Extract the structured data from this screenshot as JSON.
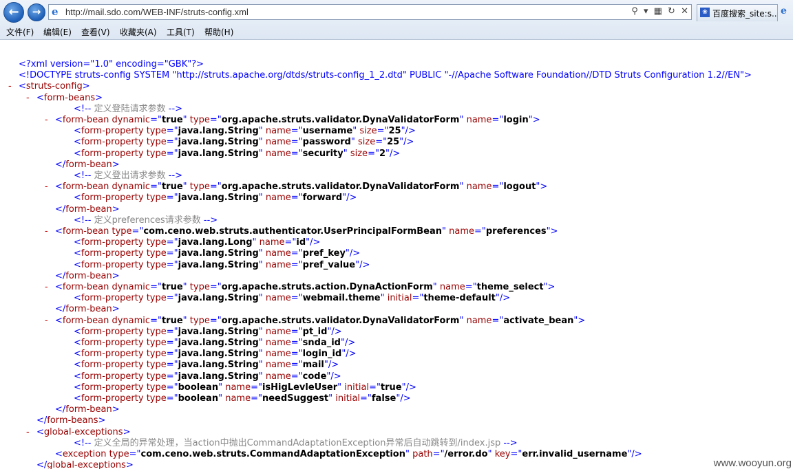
{
  "browser": {
    "url": "http://mail.sdo.com/WEB-INF/struts-config.xml",
    "tab_title": "百度搜索_site:s...",
    "menu": [
      "文件(F)",
      "编辑(E)",
      "查看(V)",
      "收藏夹(A)",
      "工具(T)",
      "帮助(H)"
    ],
    "icons": [
      "back-arrow-icon",
      "forward-arrow-icon",
      "ie-icon",
      "search-icon",
      "dropdown-icon",
      "compatibility-icon",
      "refresh-icon",
      "stop-icon",
      "baidu-icon"
    ]
  },
  "xml_lines": [
    {
      "indent": 0,
      "parts": [
        [
          "blue",
          "<?xml version=\"1.0\" encoding=\"GBK\"?>"
        ]
      ]
    },
    {
      "indent": 0,
      "parts": [
        [
          "blue",
          "<!DOCTYPE struts-config SYSTEM \"http://struts.apache.org/dtds/struts-config_1_2.dtd\" PUBLIC \"-//Apache Software Foundation//DTD Struts Configuration 1.2//EN\">"
        ]
      ]
    },
    {
      "indent": 0,
      "collapse": "-",
      "parts": [
        [
          "blue",
          "<"
        ],
        [
          "red",
          "struts-config"
        ],
        [
          "blue",
          ">"
        ]
      ]
    },
    {
      "indent": 1,
      "collapse": "-",
      "parts": [
        [
          "blue",
          "<"
        ],
        [
          "red",
          "form-beans"
        ],
        [
          "blue",
          ">"
        ]
      ]
    },
    {
      "indent": 3,
      "parts": [
        [
          "blue",
          "<!--"
        ],
        [
          "cmt",
          " 定义登陆请求参数 "
        ],
        [
          "blue",
          "-->"
        ]
      ]
    },
    {
      "indent": 2,
      "collapse": "-",
      "parts": [
        [
          "blue",
          "<"
        ],
        [
          "red",
          "form-bean dynamic"
        ],
        [
          "blue",
          "=\""
        ],
        [
          "val",
          "true"
        ],
        [
          "blue",
          "\" "
        ],
        [
          "red",
          "type"
        ],
        [
          "blue",
          "=\""
        ],
        [
          "val",
          "org.apache.struts.validator.DynaValidatorForm"
        ],
        [
          "blue",
          "\" "
        ],
        [
          "red",
          "name"
        ],
        [
          "blue",
          "=\""
        ],
        [
          "val",
          "login"
        ],
        [
          "blue",
          "\">"
        ]
      ]
    },
    {
      "indent": 3,
      "parts": [
        [
          "blue",
          "<"
        ],
        [
          "red",
          "form-property type"
        ],
        [
          "blue",
          "=\""
        ],
        [
          "val",
          "java.lang.String"
        ],
        [
          "blue",
          "\" "
        ],
        [
          "red",
          "name"
        ],
        [
          "blue",
          "=\""
        ],
        [
          "val",
          "username"
        ],
        [
          "blue",
          "\" "
        ],
        [
          "red",
          "size"
        ],
        [
          "blue",
          "=\""
        ],
        [
          "val",
          "25"
        ],
        [
          "blue",
          "\"/>"
        ]
      ]
    },
    {
      "indent": 3,
      "parts": [
        [
          "blue",
          "<"
        ],
        [
          "red",
          "form-property type"
        ],
        [
          "blue",
          "=\""
        ],
        [
          "val",
          "java.lang.String"
        ],
        [
          "blue",
          "\" "
        ],
        [
          "red",
          "name"
        ],
        [
          "blue",
          "=\""
        ],
        [
          "val",
          "password"
        ],
        [
          "blue",
          "\" "
        ],
        [
          "red",
          "size"
        ],
        [
          "blue",
          "=\""
        ],
        [
          "val",
          "25"
        ],
        [
          "blue",
          "\"/>"
        ]
      ]
    },
    {
      "indent": 3,
      "parts": [
        [
          "blue",
          "<"
        ],
        [
          "red",
          "form-property type"
        ],
        [
          "blue",
          "=\""
        ],
        [
          "val",
          "java.lang.String"
        ],
        [
          "blue",
          "\" "
        ],
        [
          "red",
          "name"
        ],
        [
          "blue",
          "=\""
        ],
        [
          "val",
          "security"
        ],
        [
          "blue",
          "\" "
        ],
        [
          "red",
          "size"
        ],
        [
          "blue",
          "=\""
        ],
        [
          "val",
          "2"
        ],
        [
          "blue",
          "\"/>"
        ]
      ]
    },
    {
      "indent": 2,
      "parts": [
        [
          "blue",
          "</"
        ],
        [
          "red",
          "form-bean"
        ],
        [
          "blue",
          ">"
        ]
      ]
    },
    {
      "indent": 3,
      "parts": [
        [
          "blue",
          "<!--"
        ],
        [
          "cmt",
          " 定义登出请求参数 "
        ],
        [
          "blue",
          "-->"
        ]
      ]
    },
    {
      "indent": 2,
      "collapse": "-",
      "parts": [
        [
          "blue",
          "<"
        ],
        [
          "red",
          "form-bean dynamic"
        ],
        [
          "blue",
          "=\""
        ],
        [
          "val",
          "true"
        ],
        [
          "blue",
          "\" "
        ],
        [
          "red",
          "type"
        ],
        [
          "blue",
          "=\""
        ],
        [
          "val",
          "org.apache.struts.validator.DynaValidatorForm"
        ],
        [
          "blue",
          "\" "
        ],
        [
          "red",
          "name"
        ],
        [
          "blue",
          "=\""
        ],
        [
          "val",
          "logout"
        ],
        [
          "blue",
          "\">"
        ]
      ]
    },
    {
      "indent": 3,
      "parts": [
        [
          "blue",
          "<"
        ],
        [
          "red",
          "form-property type"
        ],
        [
          "blue",
          "=\""
        ],
        [
          "val",
          "java.lang.String"
        ],
        [
          "blue",
          "\" "
        ],
        [
          "red",
          "name"
        ],
        [
          "blue",
          "=\""
        ],
        [
          "val",
          "forward"
        ],
        [
          "blue",
          "\"/>"
        ]
      ]
    },
    {
      "indent": 2,
      "parts": [
        [
          "blue",
          "</"
        ],
        [
          "red",
          "form-bean"
        ],
        [
          "blue",
          ">"
        ]
      ]
    },
    {
      "indent": 3,
      "parts": [
        [
          "blue",
          "<!--"
        ],
        [
          "cmt",
          " 定义preferences请求参数 "
        ],
        [
          "blue",
          "-->"
        ]
      ]
    },
    {
      "indent": 2,
      "collapse": "-",
      "parts": [
        [
          "blue",
          "<"
        ],
        [
          "red",
          "form-bean type"
        ],
        [
          "blue",
          "=\""
        ],
        [
          "val",
          "com.ceno.web.struts.authenticator.UserPrincipalFormBean"
        ],
        [
          "blue",
          "\" "
        ],
        [
          "red",
          "name"
        ],
        [
          "blue",
          "=\""
        ],
        [
          "val",
          "preferences"
        ],
        [
          "blue",
          "\">"
        ]
      ]
    },
    {
      "indent": 3,
      "parts": [
        [
          "blue",
          "<"
        ],
        [
          "red",
          "form-property type"
        ],
        [
          "blue",
          "=\""
        ],
        [
          "val",
          "java.lang.Long"
        ],
        [
          "blue",
          "\" "
        ],
        [
          "red",
          "name"
        ],
        [
          "blue",
          "=\""
        ],
        [
          "val",
          "id"
        ],
        [
          "blue",
          "\"/>"
        ]
      ]
    },
    {
      "indent": 3,
      "parts": [
        [
          "blue",
          "<"
        ],
        [
          "red",
          "form-property type"
        ],
        [
          "blue",
          "=\""
        ],
        [
          "val",
          "java.lang.String"
        ],
        [
          "blue",
          "\" "
        ],
        [
          "red",
          "name"
        ],
        [
          "blue",
          "=\""
        ],
        [
          "val",
          "pref_key"
        ],
        [
          "blue",
          "\"/>"
        ]
      ]
    },
    {
      "indent": 3,
      "parts": [
        [
          "blue",
          "<"
        ],
        [
          "red",
          "form-property type"
        ],
        [
          "blue",
          "=\""
        ],
        [
          "val",
          "java.lang.String"
        ],
        [
          "blue",
          "\" "
        ],
        [
          "red",
          "name"
        ],
        [
          "blue",
          "=\""
        ],
        [
          "val",
          "pref_value"
        ],
        [
          "blue",
          "\"/>"
        ]
      ]
    },
    {
      "indent": 2,
      "parts": [
        [
          "blue",
          "</"
        ],
        [
          "red",
          "form-bean"
        ],
        [
          "blue",
          ">"
        ]
      ]
    },
    {
      "indent": 2,
      "collapse": "-",
      "parts": [
        [
          "blue",
          "<"
        ],
        [
          "red",
          "form-bean dynamic"
        ],
        [
          "blue",
          "=\""
        ],
        [
          "val",
          "true"
        ],
        [
          "blue",
          "\" "
        ],
        [
          "red",
          "type"
        ],
        [
          "blue",
          "=\""
        ],
        [
          "val",
          "org.apache.struts.action.DynaActionForm"
        ],
        [
          "blue",
          "\" "
        ],
        [
          "red",
          "name"
        ],
        [
          "blue",
          "=\""
        ],
        [
          "val",
          "theme_select"
        ],
        [
          "blue",
          "\">"
        ]
      ]
    },
    {
      "indent": 3,
      "parts": [
        [
          "blue",
          "<"
        ],
        [
          "red",
          "form-property type"
        ],
        [
          "blue",
          "=\""
        ],
        [
          "val",
          "java.lang.String"
        ],
        [
          "blue",
          "\" "
        ],
        [
          "red",
          "name"
        ],
        [
          "blue",
          "=\""
        ],
        [
          "val",
          "webmail.theme"
        ],
        [
          "blue",
          "\" "
        ],
        [
          "red",
          "initial"
        ],
        [
          "blue",
          "=\""
        ],
        [
          "val",
          "theme-default"
        ],
        [
          "blue",
          "\"/>"
        ]
      ]
    },
    {
      "indent": 2,
      "parts": [
        [
          "blue",
          "</"
        ],
        [
          "red",
          "form-bean"
        ],
        [
          "blue",
          ">"
        ]
      ]
    },
    {
      "indent": 2,
      "collapse": "-",
      "parts": [
        [
          "blue",
          "<"
        ],
        [
          "red",
          "form-bean dynamic"
        ],
        [
          "blue",
          "=\""
        ],
        [
          "val",
          "true"
        ],
        [
          "blue",
          "\" "
        ],
        [
          "red",
          "type"
        ],
        [
          "blue",
          "=\""
        ],
        [
          "val",
          "org.apache.struts.validator.DynaValidatorForm"
        ],
        [
          "blue",
          "\" "
        ],
        [
          "red",
          "name"
        ],
        [
          "blue",
          "=\""
        ],
        [
          "val",
          "activate_bean"
        ],
        [
          "blue",
          "\">"
        ]
      ]
    },
    {
      "indent": 3,
      "parts": [
        [
          "blue",
          "<"
        ],
        [
          "red",
          "form-property type"
        ],
        [
          "blue",
          "=\""
        ],
        [
          "val",
          "java.lang.String"
        ],
        [
          "blue",
          "\" "
        ],
        [
          "red",
          "name"
        ],
        [
          "blue",
          "=\""
        ],
        [
          "val",
          "pt_id"
        ],
        [
          "blue",
          "\"/>"
        ]
      ]
    },
    {
      "indent": 3,
      "parts": [
        [
          "blue",
          "<"
        ],
        [
          "red",
          "form-property type"
        ],
        [
          "blue",
          "=\""
        ],
        [
          "val",
          "java.lang.String"
        ],
        [
          "blue",
          "\" "
        ],
        [
          "red",
          "name"
        ],
        [
          "blue",
          "=\""
        ],
        [
          "val",
          "snda_id"
        ],
        [
          "blue",
          "\"/>"
        ]
      ]
    },
    {
      "indent": 3,
      "parts": [
        [
          "blue",
          "<"
        ],
        [
          "red",
          "form-property type"
        ],
        [
          "blue",
          "=\""
        ],
        [
          "val",
          "java.lang.String"
        ],
        [
          "blue",
          "\" "
        ],
        [
          "red",
          "name"
        ],
        [
          "blue",
          "=\""
        ],
        [
          "val",
          "login_id"
        ],
        [
          "blue",
          "\"/>"
        ]
      ]
    },
    {
      "indent": 3,
      "parts": [
        [
          "blue",
          "<"
        ],
        [
          "red",
          "form-property type"
        ],
        [
          "blue",
          "=\""
        ],
        [
          "val",
          "java.lang.String"
        ],
        [
          "blue",
          "\" "
        ],
        [
          "red",
          "name"
        ],
        [
          "blue",
          "=\""
        ],
        [
          "val",
          "mail"
        ],
        [
          "blue",
          "\"/>"
        ]
      ]
    },
    {
      "indent": 3,
      "parts": [
        [
          "blue",
          "<"
        ],
        [
          "red",
          "form-property type"
        ],
        [
          "blue",
          "=\""
        ],
        [
          "val",
          "java.lang.String"
        ],
        [
          "blue",
          "\" "
        ],
        [
          "red",
          "name"
        ],
        [
          "blue",
          "=\""
        ],
        [
          "val",
          "code"
        ],
        [
          "blue",
          "\"/>"
        ]
      ]
    },
    {
      "indent": 3,
      "parts": [
        [
          "blue",
          "<"
        ],
        [
          "red",
          "form-property type"
        ],
        [
          "blue",
          "=\""
        ],
        [
          "val",
          "boolean"
        ],
        [
          "blue",
          "\" "
        ],
        [
          "red",
          "name"
        ],
        [
          "blue",
          "=\""
        ],
        [
          "val",
          "isHigLevleUser"
        ],
        [
          "blue",
          "\" "
        ],
        [
          "red",
          "initial"
        ],
        [
          "blue",
          "=\""
        ],
        [
          "val",
          "true"
        ],
        [
          "blue",
          "\"/>"
        ]
      ]
    },
    {
      "indent": 3,
      "parts": [
        [
          "blue",
          "<"
        ],
        [
          "red",
          "form-property type"
        ],
        [
          "blue",
          "=\""
        ],
        [
          "val",
          "boolean"
        ],
        [
          "blue",
          "\" "
        ],
        [
          "red",
          "name"
        ],
        [
          "blue",
          "=\""
        ],
        [
          "val",
          "needSuggest"
        ],
        [
          "blue",
          "\" "
        ],
        [
          "red",
          "initial"
        ],
        [
          "blue",
          "=\""
        ],
        [
          "val",
          "false"
        ],
        [
          "blue",
          "\"/>"
        ]
      ]
    },
    {
      "indent": 2,
      "parts": [
        [
          "blue",
          "</"
        ],
        [
          "red",
          "form-bean"
        ],
        [
          "blue",
          ">"
        ]
      ]
    },
    {
      "indent": 1,
      "parts": [
        [
          "blue",
          "</"
        ],
        [
          "red",
          "form-beans"
        ],
        [
          "blue",
          ">"
        ]
      ]
    },
    {
      "indent": 1,
      "collapse": "-",
      "parts": [
        [
          "blue",
          "<"
        ],
        [
          "red",
          "global-exceptions"
        ],
        [
          "blue",
          ">"
        ]
      ]
    },
    {
      "indent": 3,
      "parts": [
        [
          "blue",
          "<!--"
        ],
        [
          "cmt",
          " 定义全局的异常处理，当action中抛出CommandAdaptationException异常后自动跳转到/index.jsp "
        ],
        [
          "blue",
          "-->"
        ]
      ]
    },
    {
      "indent": 2,
      "parts": [
        [
          "blue",
          "<"
        ],
        [
          "red",
          "exception type"
        ],
        [
          "blue",
          "=\""
        ],
        [
          "val",
          "com.ceno.web.struts.CommandAdaptationException"
        ],
        [
          "blue",
          "\" "
        ],
        [
          "red",
          "path"
        ],
        [
          "blue",
          "=\""
        ],
        [
          "val",
          "/error.do"
        ],
        [
          "blue",
          "\" "
        ],
        [
          "red",
          "key"
        ],
        [
          "blue",
          "=\""
        ],
        [
          "val",
          "err.invalid_username"
        ],
        [
          "blue",
          "\"/>"
        ]
      ]
    },
    {
      "indent": 1,
      "parts": [
        [
          "blue",
          "</"
        ],
        [
          "red",
          "global-exceptions"
        ],
        [
          "blue",
          ">"
        ]
      ]
    }
  ],
  "watermark": "www.wooyun.org"
}
